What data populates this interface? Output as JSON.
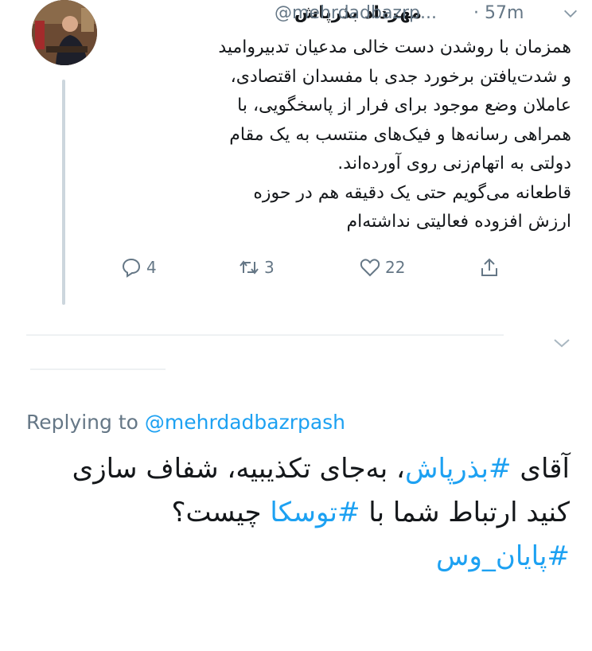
{
  "tweet": {
    "author_name": "مهرداد بذرپاش",
    "handle": "@mehrdadbazrp...",
    "time": "· 57m",
    "text_lines": [
      "همزمان با روشدن دست خالی مدعیان تدبیروامید",
      "و شدت‌یافتن برخورد جدی با مفسدان اقتصادی،",
      "عاملان وضع موجود برای فرار از پاسخگویی، با",
      "همراهی رسانه‌ها و فیک‌های منتسب به یک مقام",
      "دولتی به اتهام‌زنی روی آورده‌اند.",
      "قاطعانه می‌گویم حتی یک دقیقه هم در حوزه",
      "ارزش افزوده فعالیتی نداشته‌ام"
    ],
    "replies": "4",
    "retweets": "3",
    "likes": "22"
  },
  "reply": {
    "replying_prefix": "Replying to",
    "replying_handle": "@mehrdadbazrpash",
    "line1_a": "آقای",
    "line1_tag": "#بذرپاش",
    "line1_b": "، به‌جای تکذیبیه، شفاف سازی",
    "line2_a": "کنید ارتباط شما با",
    "line2_tag": "#توسکا",
    "line2_b": "چیست؟",
    "line3_tag": "#پایان_وس"
  },
  "colors": {
    "link": "#1da1f2",
    "muted": "#657786",
    "thread": "#ccd6dd"
  },
  "icons": [
    "chevron-down-icon",
    "reply-icon",
    "retweet-icon",
    "like-icon",
    "share-icon"
  ]
}
